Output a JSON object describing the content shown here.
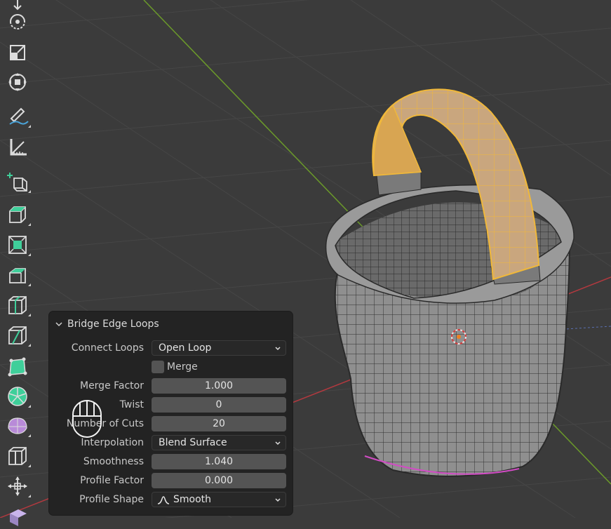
{
  "toolbar": {
    "tools": [
      {
        "name": "move-tool",
        "icon": "move-arrow-icon"
      },
      {
        "name": "rotate-tool",
        "icon": "rotate-icon"
      },
      {
        "name": "scale-tool",
        "icon": "scale-icon"
      },
      {
        "name": "transform-tool",
        "icon": "transform-icon"
      },
      {
        "name": "annotate-tool",
        "icon": "annotate-pencil-icon"
      },
      {
        "name": "measure-tool",
        "icon": "measure-ruler-icon"
      },
      {
        "name": "add-cube-tool",
        "icon": "add-cube-icon"
      },
      {
        "name": "extrude-region-tool",
        "icon": "extrude-icon"
      },
      {
        "name": "inset-faces-tool",
        "icon": "inset-faces-icon"
      },
      {
        "name": "bevel-tool",
        "icon": "bevel-icon"
      },
      {
        "name": "loop-cut-tool",
        "icon": "loop-cut-icon"
      },
      {
        "name": "knife-tool",
        "icon": "knife-icon"
      },
      {
        "name": "poly-build-tool",
        "icon": "poly-build-icon"
      },
      {
        "name": "spin-tool",
        "icon": "spin-icon"
      },
      {
        "name": "smooth-tool",
        "icon": "smooth-icon"
      },
      {
        "name": "edge-slide-tool",
        "icon": "edge-slide-icon"
      },
      {
        "name": "shrink-fatten-tool",
        "icon": "shrink-fatten-icon"
      },
      {
        "name": "shear-tool",
        "icon": "shear-icon"
      }
    ]
  },
  "panel": {
    "title": "Bridge Edge Loops",
    "connect_loops": {
      "label": "Connect Loops",
      "value": "Open Loop"
    },
    "merge": {
      "label": "Merge",
      "checked": false
    },
    "merge_factor": {
      "label": "Merge Factor",
      "value": "1.000"
    },
    "twist": {
      "label": "Twist",
      "value": "0"
    },
    "number_of_cuts": {
      "label": "Number of Cuts",
      "value": "20"
    },
    "interpolation": {
      "label": "Interpolation",
      "value": "Blend Surface"
    },
    "smoothness": {
      "label": "Smoothness",
      "value": "1.040"
    },
    "profile_factor": {
      "label": "Profile Factor",
      "value": "0.000"
    },
    "profile_shape": {
      "label": "Profile Shape",
      "value": "Smooth"
    }
  },
  "colors": {
    "background": "#3b3b3b",
    "grid_line": "#454545",
    "x_axis": "#b3393f",
    "y_axis": "#6b9a2a",
    "mesh_face": "#8e8e8e",
    "mesh_edge": "#2b2b2b",
    "selected_face": "#d6a664",
    "selected_edge": "#f0b83a",
    "panel_bg": "#232323",
    "field_bg": "#545454"
  }
}
